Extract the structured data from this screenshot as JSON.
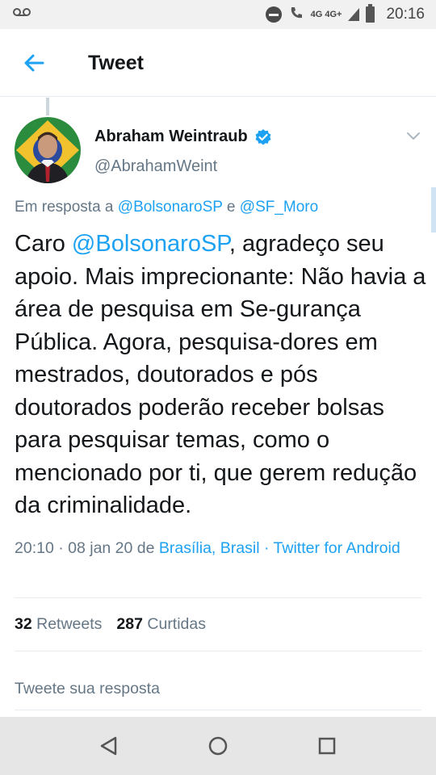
{
  "status_bar": {
    "voicemail_icon": "voicemail-icon",
    "network": "4G 4G+",
    "time": "20:16"
  },
  "header": {
    "title": "Tweet",
    "back_icon": "arrow-left-icon"
  },
  "tweet": {
    "author_name": "Abraham Weintraub",
    "author_handle": "@AbrahamWeint",
    "verified": true,
    "reply_prefix": "Em resposta a",
    "reply_user_1": "@BolsonaroSP",
    "reply_joiner": "e",
    "reply_user_2": "@SF_Moro",
    "text_prefix": "Caro",
    "text_mention": "@BolsonaroSP",
    "text_body": ", agradeço seu apoio. Mais imprecionante: Não havia a área de pesquisa em Se-gurança Pública. Agora, pesquisa-dores em mestrados, doutorados e pós doutorados poderão receber bolsas para pesquisar temas, como o mencionado por ti, que gerem redução da criminalidade.",
    "timestamp": "20:10 · 08 jan 20 de",
    "location": "Brasília, Brasil",
    "separator": "·",
    "source": "Twitter for Android"
  },
  "stats": {
    "retweets_count": "32",
    "retweets_label": "Retweets",
    "likes_count": "287",
    "likes_label": "Curtidas"
  },
  "reply": {
    "placeholder": "Tweete sua resposta"
  },
  "colors": {
    "link": "#1da1f2",
    "muted": "#657786",
    "text": "#14171a"
  }
}
